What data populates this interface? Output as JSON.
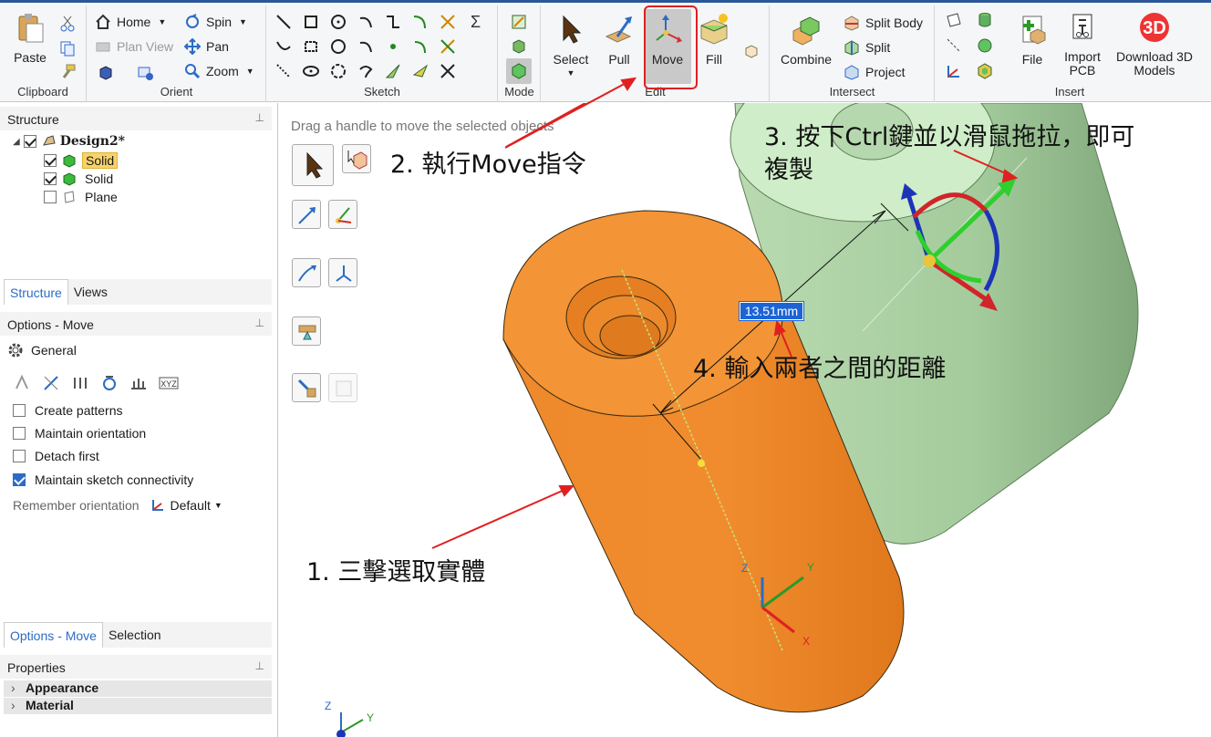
{
  "ribbon": {
    "clipboard": {
      "label": "Clipboard",
      "paste": "Paste"
    },
    "orient": {
      "label": "Orient",
      "home": "Home",
      "plan_view": "Plan View",
      "spin": "Spin",
      "pan": "Pan",
      "zoom": "Zoom"
    },
    "sketch": {
      "label": "Sketch"
    },
    "mode": {
      "label": "Mode"
    },
    "edit": {
      "label": "Edit",
      "select": "Select",
      "pull": "Pull",
      "move": "Move",
      "fill": "Fill"
    },
    "intersect": {
      "label": "Intersect",
      "combine": "Combine",
      "split_body": "Split Body",
      "split": "Split",
      "project": "Project"
    },
    "insert": {
      "label": "Insert",
      "file": "File",
      "import_pcb_1": "Import",
      "import_pcb_2": "PCB",
      "download_1": "Download 3D",
      "download_2": "Models",
      "download_badge": "3D"
    }
  },
  "structure": {
    "title": "Structure",
    "root": "Design2*",
    "items": [
      {
        "label": "Solid",
        "checked": true,
        "selected": true
      },
      {
        "label": "Solid",
        "checked": true,
        "selected": false
      },
      {
        "label": "Plane",
        "checked": false,
        "selected": false
      }
    ],
    "tabs": [
      "Structure",
      "Views"
    ]
  },
  "options": {
    "title": "Options - Move",
    "general": "General",
    "checks": [
      {
        "label": "Create patterns",
        "checked": false
      },
      {
        "label": "Maintain orientation",
        "checked": false
      },
      {
        "label": "Detach first",
        "checked": false
      },
      {
        "label": "Maintain sketch connectivity",
        "checked": true
      }
    ],
    "remember_label": "Remember orientation",
    "remember_value": "Default",
    "tabs": [
      "Options - Move",
      "Selection"
    ]
  },
  "properties": {
    "title": "Properties",
    "rows": [
      "Appearance",
      "Material"
    ]
  },
  "viewport": {
    "hint": "Drag a handle to move the selected objects",
    "dimension": "13.51mm",
    "annotations": {
      "step1": "1. 三擊選取實體",
      "step2": "2. 執行Move指令",
      "step3a": "3. 按下Ctrl鍵並以滑鼠拖拉，即可",
      "step3b": "複製",
      "step4": "4. 輸入兩者之間的距離"
    },
    "axes": {
      "x": "X",
      "y": "Y",
      "z": "Z"
    }
  },
  "colors": {
    "orange_body": "#f28b2c",
    "green_body": "#a8cfa0",
    "accent_blue": "#2b6cc4",
    "arrow_red": "#e02020"
  }
}
